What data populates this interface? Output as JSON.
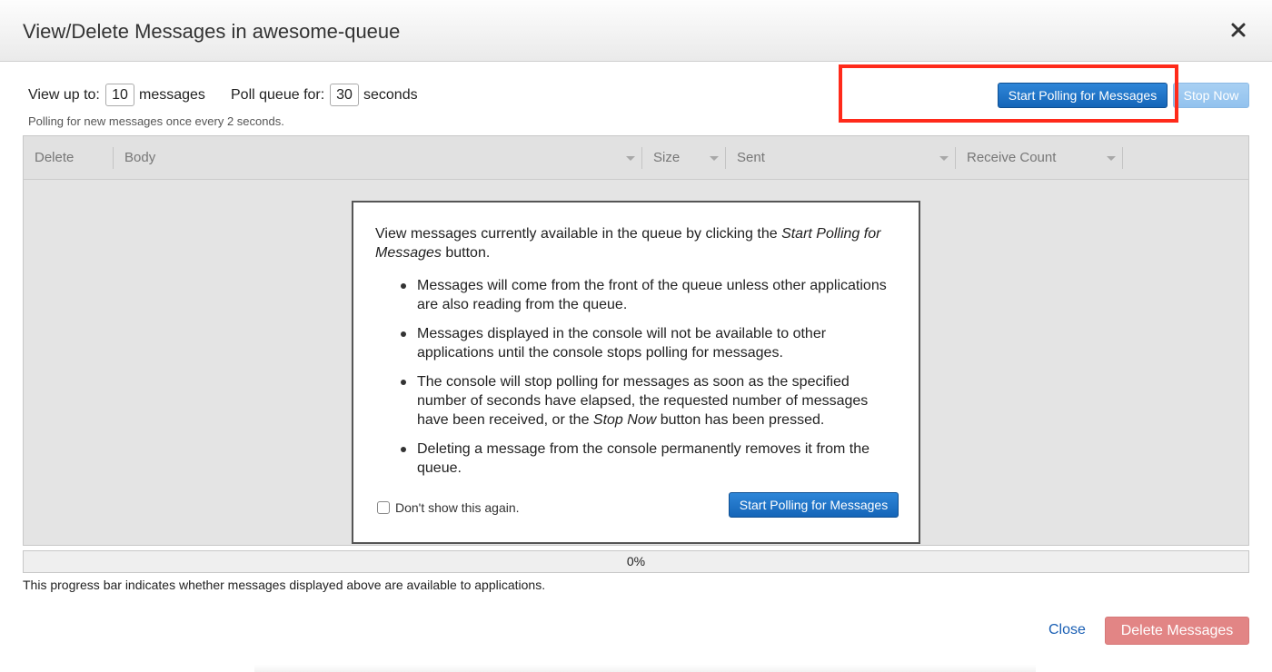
{
  "dialog": {
    "title": "View/Delete Messages in awesome-queue",
    "close_icon": "close-x-icon"
  },
  "controls": {
    "view_up_to_label": "View up to:",
    "view_up_to_value": "10",
    "messages_label": "messages",
    "poll_queue_label": "Poll queue for:",
    "poll_queue_value": "30",
    "seconds_label": "seconds",
    "polling_note": "Polling for new messages once every 2 seconds.",
    "start_polling_label": "Start Polling for Messages",
    "stop_now_label": "Stop Now"
  },
  "grid": {
    "columns": [
      "Delete",
      "Body",
      "Size",
      "Sent",
      "Receive Count"
    ]
  },
  "info": {
    "intro_pre": "View messages currently available in the queue by clicking the ",
    "intro_em": "Start Polling for Messages",
    "intro_post": " button.",
    "item1": "Messages will come from the front of the queue unless other applications are also reading from the queue.",
    "item2": "Messages displayed in the console will not be available to other applications until the console stops polling for messages.",
    "item3_pre": "The console will stop polling for messages as soon as the specified number of seconds have elapsed, the requested number of messages have been received, or the ",
    "item3_em": "Stop Now",
    "item3_post": " button has been pressed.",
    "item4": "Deleting a message from the console permanently removes it from the queue.",
    "dont_show_label": "Don't show this again.",
    "dont_show_checked": false,
    "start_polling_label": "Start Polling for Messages"
  },
  "progress": {
    "value_percent": 0,
    "text": "0%",
    "note": "This progress bar indicates whether messages displayed above are available to applications."
  },
  "footer": {
    "close_label": "Close",
    "delete_label": "Delete Messages"
  },
  "colors": {
    "primary_button": "#1a6fc4",
    "disabled_button": "#9ecaf1",
    "highlight": "#ff2a1a",
    "delete_button": "#e28585",
    "link": "#1a5fb4"
  }
}
